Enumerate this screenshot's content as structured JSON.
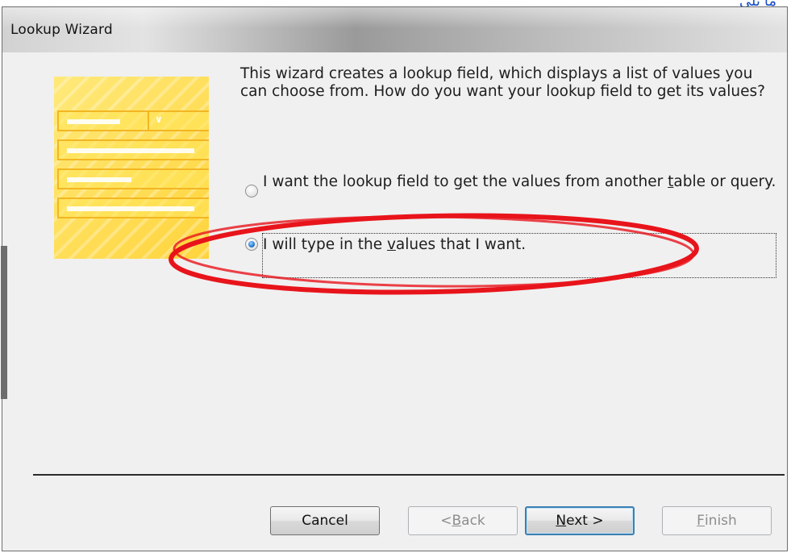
{
  "top_link": "ما يلي",
  "window": {
    "title": "Lookup Wizard"
  },
  "intro_text": "This wizard creates a lookup field, which displays a list of values you can choose from.  How do you want your lookup field to get its values?",
  "options": [
    {
      "pre": "I want the lookup field to get the values from another ",
      "accel": "t",
      "post": "able or query.",
      "selected": false
    },
    {
      "pre": "I will type in the ",
      "accel": "v",
      "post": "alues that I want.",
      "selected": true
    }
  ],
  "buttons": {
    "cancel": {
      "label": "Cancel"
    },
    "back": {
      "accel": "B",
      "pre": "< ",
      "post": "ack"
    },
    "next": {
      "accel": "N",
      "pre": "",
      "post": "ext >"
    },
    "finish": {
      "accel": "F",
      "pre": "",
      "post": "inish"
    }
  },
  "colors": {
    "annotation": "#e8141b",
    "accent": "#3c7fb1",
    "illustration": "#ffd43c"
  }
}
